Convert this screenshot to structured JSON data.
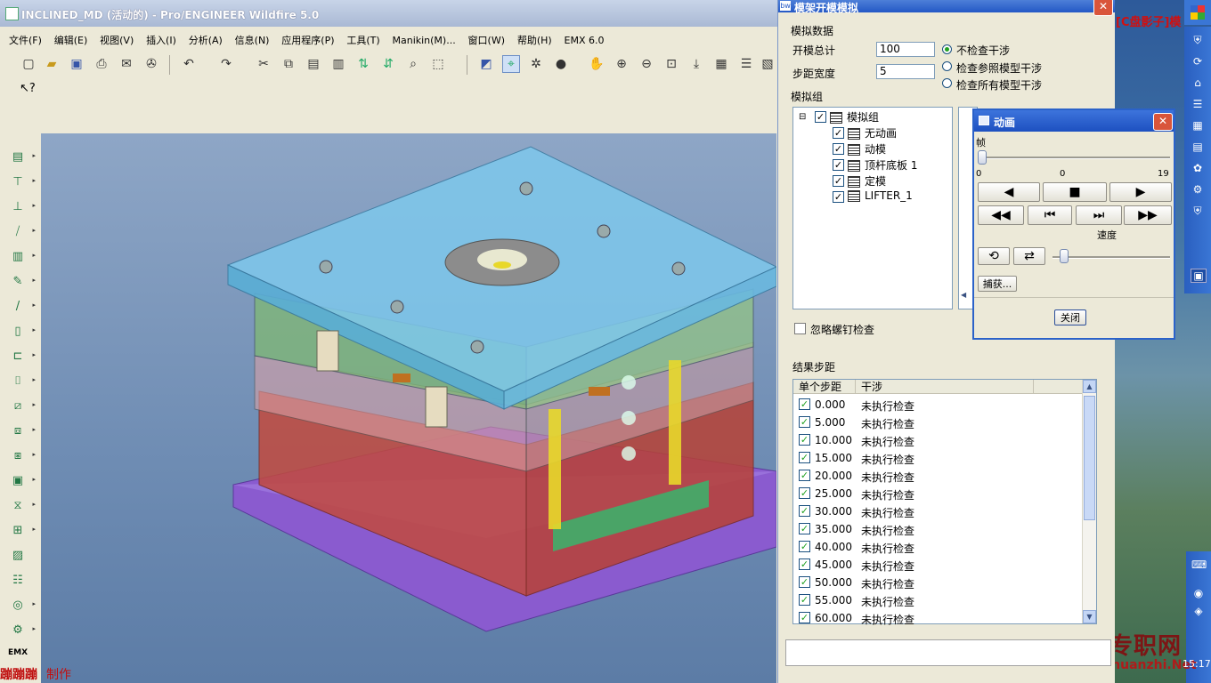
{
  "main": {
    "title": "INCLINED_MD (活动的) - Pro/ENGINEER Wildfire 5.0",
    "menu": [
      "文件(F)",
      "编辑(E)",
      "视图(V)",
      "插入(I)",
      "分析(A)",
      "信息(N)",
      "应用程序(P)",
      "工具(T)",
      "Manikin(M)...",
      "窗口(W)",
      "帮助(H)",
      "EMX 6.0"
    ],
    "footer_credit": "蹦蹦蹦",
    "footer_credit_suffix": "制作",
    "emx_label": "EMX"
  },
  "dialog": {
    "title": "模架开模模拟",
    "icon_text": "bw",
    "section_sim_data": "模拟数据",
    "total_open_label": "开模总计",
    "total_open_value": "100",
    "step_width_label": "步距宽度",
    "step_width_value": "5",
    "radio_options": [
      "不检查干涉",
      "检查参照模型干涉",
      "检查所有模型干涉"
    ],
    "radio_selected": 0,
    "sim_group_label": "模拟组",
    "tree": {
      "root": "模拟组",
      "children": [
        "无动画",
        "动模",
        "顶杆底板 1",
        "定模",
        "LIFTER_1"
      ]
    },
    "ignore_screw_label": "忽略螺钉检查",
    "results_label": "结果步距",
    "results_columns": [
      "单个步距",
      "干涉"
    ],
    "results_rows": [
      {
        "step": "0.000",
        "status": "未执行检查"
      },
      {
        "step": "5.000",
        "status": "未执行检查"
      },
      {
        "step": "10.000",
        "status": "未执行检查"
      },
      {
        "step": "15.000",
        "status": "未执行检查"
      },
      {
        "step": "20.000",
        "status": "未执行检查"
      },
      {
        "step": "25.000",
        "status": "未执行检查"
      },
      {
        "step": "30.000",
        "status": "未执行检查"
      },
      {
        "step": "35.000",
        "status": "未执行检查"
      },
      {
        "step": "40.000",
        "status": "未执行检查"
      },
      {
        "step": "45.000",
        "status": "未执行检查"
      },
      {
        "step": "50.000",
        "status": "未执行检查"
      },
      {
        "step": "55.000",
        "status": "未执行检查"
      },
      {
        "step": "60.000",
        "status": "未执行检查"
      }
    ]
  },
  "animation": {
    "title": "动画",
    "frame_label": "帧",
    "frame_min": "0",
    "frame_current": "0",
    "frame_max": "19",
    "frame_value": 0,
    "speed_label": "速度",
    "capture_label": "捕获...",
    "close_label": "关闭"
  },
  "desktop": {
    "red_label": "[C盘影子]模",
    "watermark_cn": "专职网",
    "watermark_en": "Zhuanzhi.Net",
    "clock": "15:17"
  },
  "colors": {
    "xp_blue": "#2358c5",
    "mold_top": "#7ec8ec",
    "mold_green": "#7fb873",
    "mold_red": "#c24a3e",
    "mold_base": "#8a5bcf",
    "check_green": "#21a121"
  }
}
